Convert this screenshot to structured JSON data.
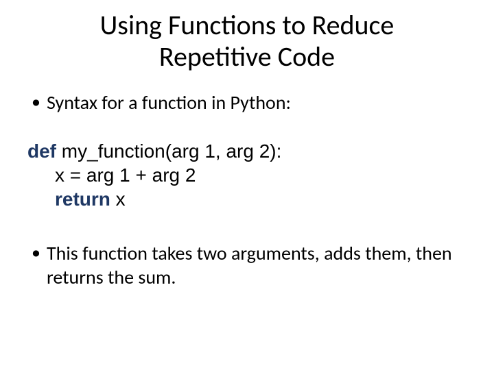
{
  "title": "Using Functions to Reduce Repetitive Code",
  "bullet1": "Syntax for a function in Python:",
  "code": {
    "def_kw": "def",
    "line1_rest": " my_function(arg 1, arg 2):",
    "line2": "x = arg 1 + arg 2",
    "return_kw": "return",
    "line3_rest": " x"
  },
  "bullet2": "This function takes two arguments, adds them, then returns the sum."
}
